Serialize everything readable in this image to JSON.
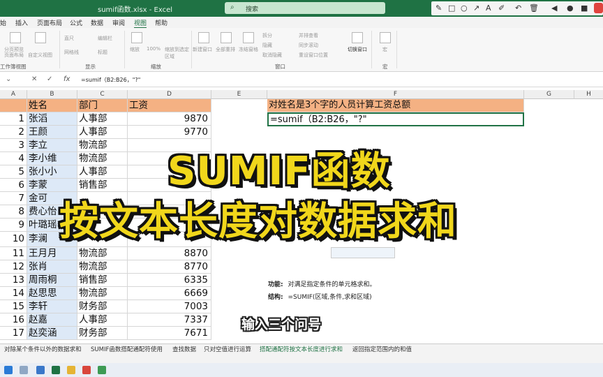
{
  "window": {
    "title": "sumif函数.xlsx - Excel",
    "search_placeholder": "搜索"
  },
  "menu": [
    "始",
    "插入",
    "页面布局",
    "公式",
    "数据",
    "审阅",
    "视图",
    "帮助"
  ],
  "menu_active": "视图",
  "ribbon": {
    "groups": [
      "工作簿视图",
      "显示",
      "缩放",
      "窗口",
      "宏"
    ],
    "items": [
      "分页预览",
      "页面布局",
      "自定义视图",
      "直尺",
      "编辑栏",
      "网格线",
      "标题",
      "缩放",
      "100%",
      "缩放到选定区域",
      "新建窗口",
      "全部重排",
      "冻结窗格",
      "拆分",
      "隐藏",
      "取消隐藏",
      "并排查看",
      "同步滚动",
      "重设窗口位置",
      "切换窗口",
      "宏"
    ]
  },
  "formula_bar": {
    "fx": "fx",
    "content": "=sumif（B2:B26，\"?\""
  },
  "columns": [
    "A",
    "B",
    "C",
    "D",
    "E",
    "F",
    "G",
    "H"
  ],
  "header_row": {
    "name": "姓名",
    "dept": "部门",
    "salary": "工资"
  },
  "rows": [
    {
      "n": "1",
      "name": "张滔",
      "dept": "人事部",
      "salary": "9870"
    },
    {
      "n": "2",
      "name": "王颜",
      "dept": "人事部",
      "salary": "9770"
    },
    {
      "n": "3",
      "name": "李立",
      "dept": "物流部",
      "salary": ""
    },
    {
      "n": "4",
      "name": "李小维",
      "dept": "物流部",
      "salary": ""
    },
    {
      "n": "5",
      "name": "张小小",
      "dept": "人事部",
      "salary": ""
    },
    {
      "n": "6",
      "name": "李蒙",
      "dept": "销售部",
      "salary": ""
    },
    {
      "n": "7",
      "name": "金可",
      "dept": "",
      "salary": ""
    },
    {
      "n": "8",
      "name": "费心怡",
      "dept": "",
      "salary": ""
    },
    {
      "n": "9",
      "name": "叶璐瑶",
      "dept": "",
      "salary": ""
    },
    {
      "n": "10",
      "name": "李澜",
      "dept": "",
      "salary": ""
    },
    {
      "n": "11",
      "name": "王月月",
      "dept": "物流部",
      "salary": "8870"
    },
    {
      "n": "12",
      "name": "张肖",
      "dept": "物流部",
      "salary": "8770"
    },
    {
      "n": "13",
      "name": "周雨桐",
      "dept": "销售部",
      "salary": "6335"
    },
    {
      "n": "14",
      "name": "赵思思",
      "dept": "物流部",
      "salary": "6669"
    },
    {
      "n": "15",
      "name": "李轩",
      "dept": "财务部",
      "salary": "7003"
    },
    {
      "n": "16",
      "name": "赵嘉",
      "dept": "人事部",
      "salary": "7337"
    },
    {
      "n": "17",
      "name": "赵奕涵",
      "dept": "财务部",
      "salary": "7671"
    }
  ],
  "task": {
    "title": "对姓名是3个字的人员计算工资总额",
    "formula": "=sumif（B2:B26，\"?\""
  },
  "notes": {
    "func_label": "功能:",
    "func_text": "对满足指定条件的单元格求和。",
    "syntax_label": "结构:",
    "syntax_text": "=SUMIF(区域,条件,求和区域)"
  },
  "overlay": {
    "line1": "SUMIF函数",
    "line2": "按文本长度对数据求和",
    "subtitle": "输入三个问号"
  },
  "sheet_tabs": [
    "对除某个条件以外的数据求和",
    "SUMIF函数搭配通配符使用",
    "查找数据",
    "只对空值进行运算",
    "搭配通配符按文本长度进行求和",
    "返回指定范围内的和值"
  ],
  "sheet_tab_active": 4,
  "colors": {
    "excel_green": "#1f7244",
    "header_fill": "#f4b183",
    "overlay_yellow": "#f1d71b"
  }
}
